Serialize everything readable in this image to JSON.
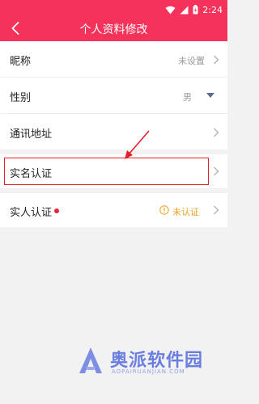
{
  "status_bar": {
    "time": "2:24",
    "battery_color": "#ffffff"
  },
  "header": {
    "title": "个人资料修改",
    "bg_color": "#f5325a"
  },
  "rows": {
    "nickname": {
      "label": "昵称",
      "value": "未设置"
    },
    "gender": {
      "label": "性别",
      "value": "男"
    },
    "address": {
      "label": "通讯地址"
    },
    "realname": {
      "label": "实名认证"
    },
    "person": {
      "label": "实人认证",
      "status": "未认证"
    }
  },
  "watermark": {
    "name": "奥派软件园",
    "url": "AOPAIRUANJIAN.COM"
  }
}
